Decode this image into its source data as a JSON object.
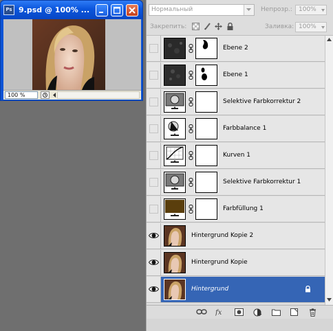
{
  "document": {
    "title": "9.psd @ 100% ...",
    "zoom": "100 %"
  },
  "panel": {
    "blend_mode": "Нормальный",
    "opacity_label": "Непрозр.:",
    "opacity_value": "100%",
    "lock_label": "Закрепить:",
    "fill_label": "Заливка:",
    "fill_value": "100%"
  },
  "layers": [
    {
      "name": "Ebene 2",
      "visible": false,
      "type": "pixel-mask"
    },
    {
      "name": "Ebene 1",
      "visible": false,
      "type": "pixel-mask"
    },
    {
      "name": "Selektive Farbkorrektur 2",
      "visible": false,
      "type": "selective-color"
    },
    {
      "name": "Farbbalance 1",
      "visible": false,
      "type": "color-balance"
    },
    {
      "name": "Kurven 1",
      "visible": false,
      "type": "curves"
    },
    {
      "name": "Selektive Farbkorrektur 1",
      "visible": false,
      "type": "selective-color"
    },
    {
      "name": "Farbfüllung 1",
      "visible": false,
      "type": "solid-fill",
      "fill_color": "#5a3e0c"
    },
    {
      "name": "Hintergrund Kopie 2",
      "visible": true,
      "type": "image"
    },
    {
      "name": "Hintergrund Kopie",
      "visible": true,
      "type": "image"
    },
    {
      "name": "Hintergrund",
      "visible": true,
      "type": "image",
      "selected": true,
      "locked": true
    }
  ],
  "colors": {
    "selection": "#3565b5",
    "titlebar": "#0a55dc",
    "close_button": "#c6401d"
  }
}
